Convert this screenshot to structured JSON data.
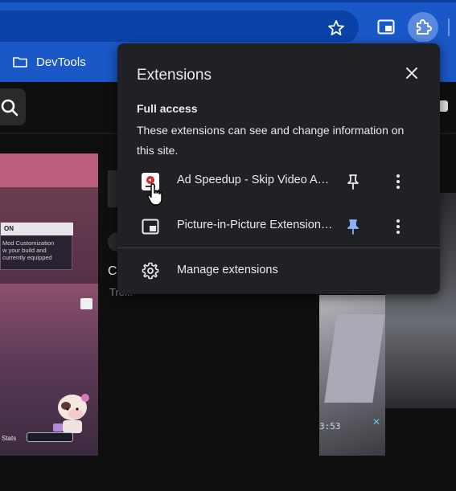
{
  "colors": {
    "chrome_blue": "#1a57c7",
    "omnibox": "#0b42a7",
    "popup_bg": "#202124",
    "popup_text": "#e8eaed",
    "pin_active": "#8ab4f8",
    "page_bg": "#0f0f10"
  },
  "toolbar": {
    "bookmark_icon": "star-icon",
    "pip_icon": "picture-in-picture-icon",
    "extensions_icon": "puzzle-piece-icon"
  },
  "bookmarks": {
    "items": [
      {
        "label": "DevTools",
        "icon": "folder-icon"
      }
    ]
  },
  "page": {
    "frag_c": "C",
    "frag_trol": "Trol.."
  },
  "thumb_left": {
    "card_heading": "ON",
    "card_line1": "Mod Customization",
    "card_line2": "w your build and",
    "card_line3": "currently equipped",
    "stats": "Stats"
  },
  "thumb_right": {
    "time": "3:53"
  },
  "extensions_popup": {
    "title": "Extensions",
    "close_icon": "close-icon",
    "section_title": "Full access",
    "section_desc": "These extensions can see and change information on this site.",
    "items": [
      {
        "name": "Ad Speedup - Skip Video Ads Faster",
        "pinned": false,
        "icon": "ad-speedup-icon"
      },
      {
        "name": "Picture-in-Picture Extension (by Google)",
        "pinned": true,
        "icon": "picture-in-picture-icon"
      }
    ],
    "manage_label": "Manage extensions",
    "manage_icon": "gear-icon"
  }
}
